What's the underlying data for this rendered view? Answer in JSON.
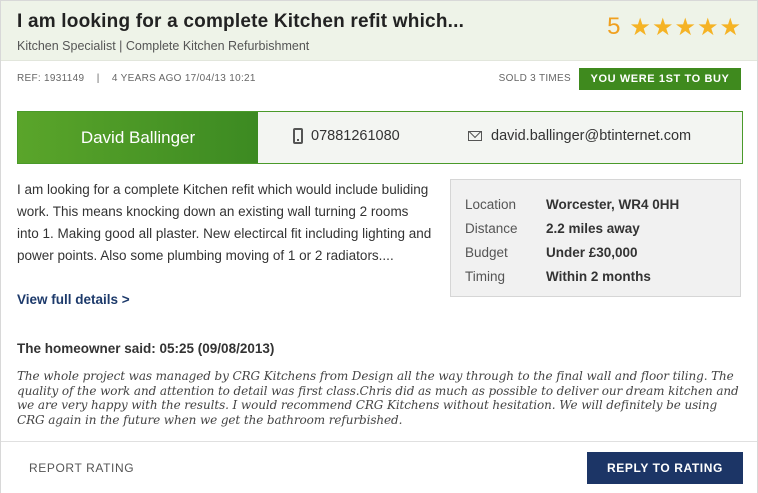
{
  "header": {
    "title": "I am looking for a complete Kitchen refit which...",
    "subtitle": "Kitchen Specialist | Complete Kitchen Refurbishment",
    "rating_value": "5",
    "stars": 5,
    "star_color": "#f5b325"
  },
  "meta": {
    "ref": "REF: 1931149",
    "separator": "|",
    "age": "4 YEARS AGO 17/04/13 10:21",
    "sold": "SOLD 3 TIMES",
    "badge": "YOU WERE 1ST TO BUY",
    "badge_color": "#3f8a1e"
  },
  "contact": {
    "name": "David Ballinger",
    "phone_icon": "phone-icon",
    "phone": "07881261080",
    "email_icon": "envelope-icon",
    "email": "david.ballinger@btinternet.com"
  },
  "description": "I am looking for a complete Kitchen refit which would include buliding work. This means knocking down an existing wall turning 2 rooms into 1. Making good all plaster. New electircal fit including lighting and power points. Also some plumbing moving of 1 or 2 radiators....",
  "view_link": "View full details >",
  "details": [
    {
      "label": "Location",
      "value": "Worcester, WR4 0HH"
    },
    {
      "label": "Distance",
      "value": "2.2 miles away"
    },
    {
      "label": "Budget",
      "value": "Under £30,000"
    },
    {
      "label": "Timing",
      "value": "Within 2 months"
    }
  ],
  "review": {
    "heading": "The homeowner said: 05:25 (09/08/2013)",
    "text": "The whole project was managed by CRG Kitchens from Design all the way through to the final wall and floor tiling. The quality of the work and attention to detail was first class.Chris did as much as possible to deliver our dream kitchen and we are very happy with the results. I would recommend CRG Kitchens without hesitation. We will definitely be using CRG again in the future when we get the bathroom refurbished."
  },
  "footer": {
    "report": "REPORT RATING",
    "reply": "REPLY TO RATING",
    "reply_color": "#1c3566"
  }
}
